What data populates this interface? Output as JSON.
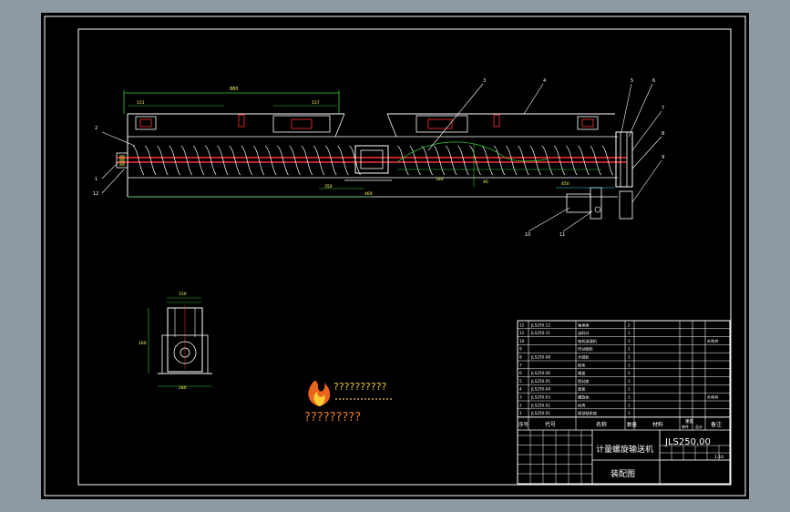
{
  "viewport": {
    "background": "#8e99a4",
    "paper": "#000000",
    "line_color": "#ffffff",
    "red": "#ff3030",
    "green": "#33cc33",
    "yellow": "#ffff66",
    "cyan": "#44dddd"
  },
  "drawing": {
    "part_labels": [
      "1",
      "2",
      "3",
      "4",
      "5",
      "6",
      "7",
      "8",
      "9",
      "10",
      "11",
      "12"
    ],
    "dim_labels": {
      "overall": "880",
      "left_a": "151",
      "left_b": "157",
      "bottom_total": "469",
      "flange": "350",
      "mid_a": "180",
      "mid_b": "40",
      "motor": "450"
    },
    "section_view": {
      "width_dim": "150",
      "height_dim": "160",
      "bottom_dim": "280"
    }
  },
  "watermark": {
    "line1": "??????????",
    "line2": "?????????"
  },
  "title_block": {
    "drawing_no": "JLS250.00",
    "title": "计量螺旋输送机",
    "subtitle": "装配图",
    "col_headers": [
      "序号",
      "代号",
      "名称",
      "数量",
      "材料",
      "单件",
      "总计",
      "备注"
    ],
    "weight_header": "重量",
    "scale": "1:10",
    "rows": [
      {
        "no": "12",
        "code": "JLS250.12",
        "name": "轴承座",
        "qty": "2",
        "note": ""
      },
      {
        "no": "11",
        "code": "JLS250-11",
        "name": "出料口",
        "qty": "1",
        "note": ""
      },
      {
        "no": "10",
        "code": "",
        "name": "电机减速机",
        "qty": "1",
        "note": "外购件"
      },
      {
        "no": "9",
        "code": "",
        "name": "传动链轮",
        "qty": "1",
        "note": ""
      },
      {
        "no": "8",
        "code": "JLS250-08",
        "name": "大链轮",
        "qty": "1",
        "note": ""
      },
      {
        "no": "7",
        "code": "",
        "name": "链条",
        "qty": "1",
        "note": ""
      },
      {
        "no": "6",
        "code": "JLS250.06",
        "name": "端盖",
        "qty": "2",
        "note": ""
      },
      {
        "no": "5",
        "code": "JLS250.05",
        "name": "密封座",
        "qty": "1",
        "note": ""
      },
      {
        "no": "4",
        "code": "JLS250-04",
        "name": "盖板",
        "qty": "1",
        "note": ""
      },
      {
        "no": "3",
        "code": "JLS250.03",
        "name": "螺旋体",
        "qty": "1",
        "note": "外购件"
      },
      {
        "no": "2",
        "code": "JLS250.02",
        "name": "机壳",
        "qty": "1",
        "note": ""
      },
      {
        "no": "1",
        "code": "JLS250.01",
        "name": "尾部轴承座",
        "qty": "1",
        "note": ""
      }
    ]
  }
}
